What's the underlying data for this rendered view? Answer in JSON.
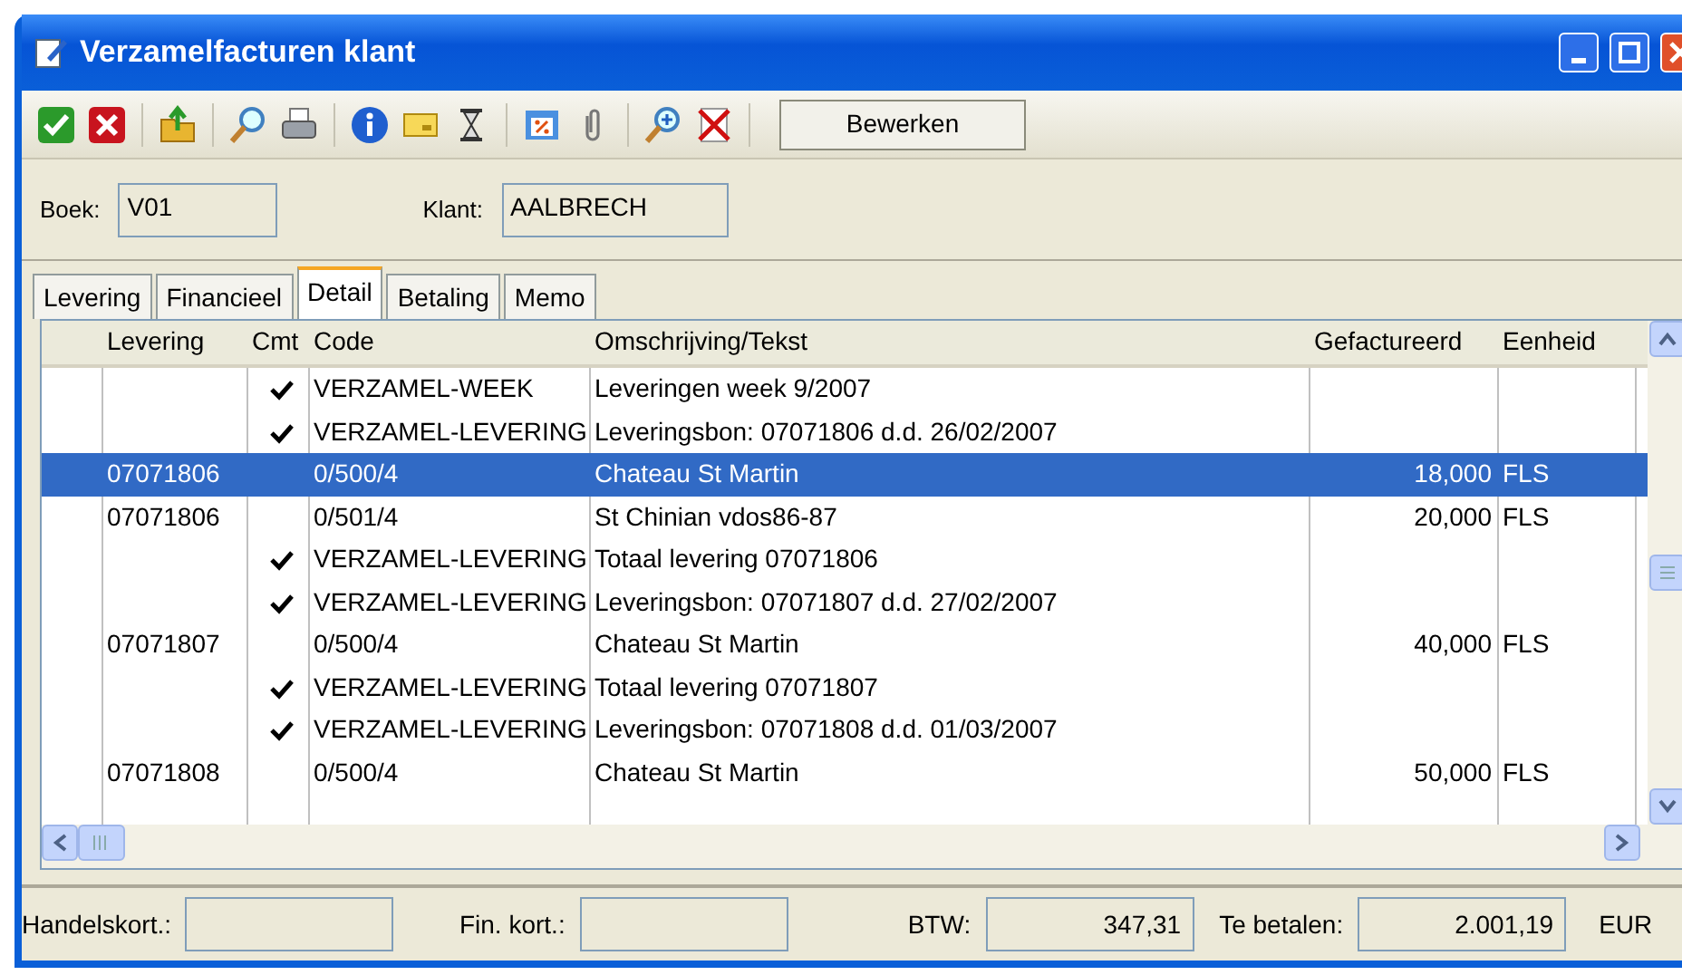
{
  "window": {
    "title": "Verzamelfacturen klant"
  },
  "toolbar": {
    "action_button": "Bewerken"
  },
  "header_fields": [
    {
      "label": "Boek:",
      "value": "V01"
    },
    {
      "label": "Klant:",
      "value": "AALBRECH"
    }
  ],
  "tabs": [
    {
      "label": "Levering",
      "selected": false
    },
    {
      "label": "Financieel",
      "selected": false
    },
    {
      "label": "Detail",
      "selected": true
    },
    {
      "label": "Betaling",
      "selected": false
    },
    {
      "label": "Memo",
      "selected": false
    }
  ],
  "table": {
    "columns": [
      "Levering",
      "Cmt",
      "Code",
      "Omschrijving/Tekst",
      "Gefactureerd",
      "Eenheid"
    ],
    "rows": [
      {
        "cmt": true,
        "code": "VERZAMEL-WEEK",
        "text": "Leveringen week 9/2007",
        "selected": false
      },
      {
        "cmt": true,
        "code": "VERZAMEL-LEVERING",
        "text": "Leveringsbon: 07071806 d.d. 26/02/2007",
        "selected": false
      },
      {
        "levering": "07071806",
        "cmt": false,
        "code": "0/500/4",
        "text": "Chateau St Martin",
        "amount": "18,000",
        "unit": "FLS",
        "selected": true
      },
      {
        "levering": "07071806",
        "cmt": false,
        "code": "0/501/4",
        "text": "St Chinian vdos86-87",
        "amount": "20,000",
        "unit": "FLS",
        "selected": false
      },
      {
        "cmt": true,
        "code": "VERZAMEL-LEVERING",
        "text": "Totaal levering 07071806",
        "selected": false
      },
      {
        "cmt": true,
        "code": "VERZAMEL-LEVERING",
        "text": "Leveringsbon: 07071807 d.d. 27/02/2007",
        "selected": false
      },
      {
        "levering": "07071807",
        "cmt": false,
        "code": "0/500/4",
        "text": "Chateau St Martin",
        "amount": "40,000",
        "unit": "FLS",
        "selected": false
      },
      {
        "cmt": true,
        "code": "VERZAMEL-LEVERING",
        "text": "Totaal levering 07071807",
        "selected": false
      },
      {
        "cmt": true,
        "code": "VERZAMEL-LEVERING",
        "text": "Leveringsbon: 07071808 d.d. 01/03/2007",
        "selected": false
      },
      {
        "levering": "07071808",
        "cmt": false,
        "code": "0/500/4",
        "text": "Chateau St Martin",
        "amount": "50,000",
        "unit": "FLS",
        "selected": false
      }
    ]
  },
  "totals": [
    {
      "label": "Handelskort.:"
    },
    {
      "label": "Fin. kort.:"
    },
    {
      "label": "BTW:",
      "value": "347,31"
    },
    {
      "label": "Te betalen:",
      "value": "2.001,19"
    }
  ],
  "currency": "EUR"
}
